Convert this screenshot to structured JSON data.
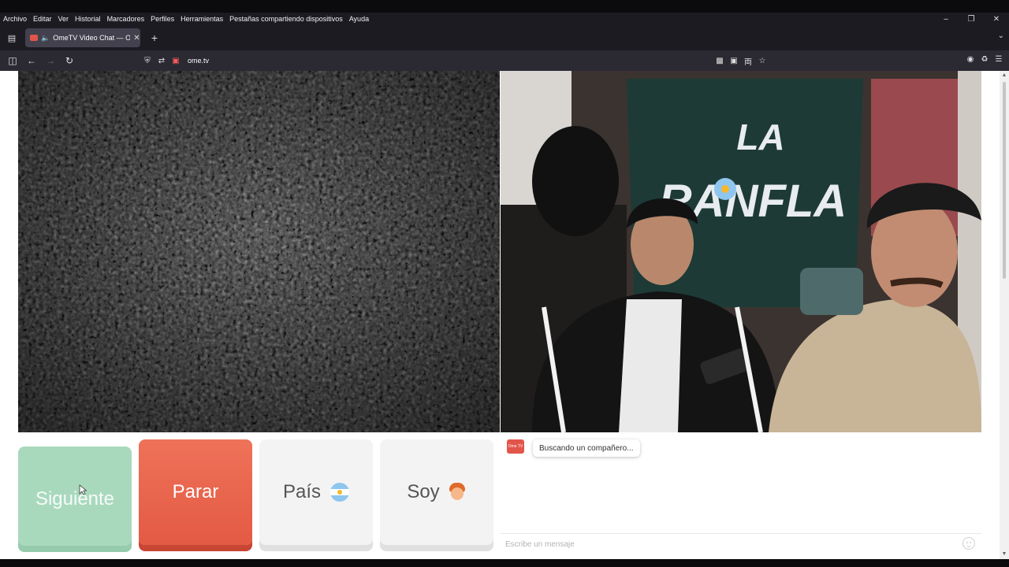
{
  "menubar": {
    "items": [
      "Archivo",
      "Editar",
      "Ver",
      "Historial",
      "Marcadores",
      "Perfiles",
      "Herramientas",
      "Pestañas compartiendo dispositivos",
      "Ayuda"
    ]
  },
  "tab": {
    "title": "OmeTV Video Chat — OmeTV",
    "close": "✕"
  },
  "navbar": {
    "url": "ome.tv"
  },
  "controls": {
    "next_label": "Siguiente",
    "stop_label": "Parar",
    "country_label": "País",
    "gender_label": "Soy"
  },
  "chat": {
    "logo_text": "Ome TV",
    "status_message": "Buscando un compañero...",
    "input_placeholder": "Escribe un mensaje"
  },
  "icons": {
    "tab_list": "tab-list-icon",
    "new_tab": "plus-icon",
    "back": "back-arrow-icon",
    "forward": "forward-arrow-icon",
    "reload": "reload-icon"
  },
  "colors": {
    "next": "#a9d9bd",
    "stop": "#e8614a",
    "neutral": "#f3f3f3",
    "brand": "#e2554b"
  }
}
